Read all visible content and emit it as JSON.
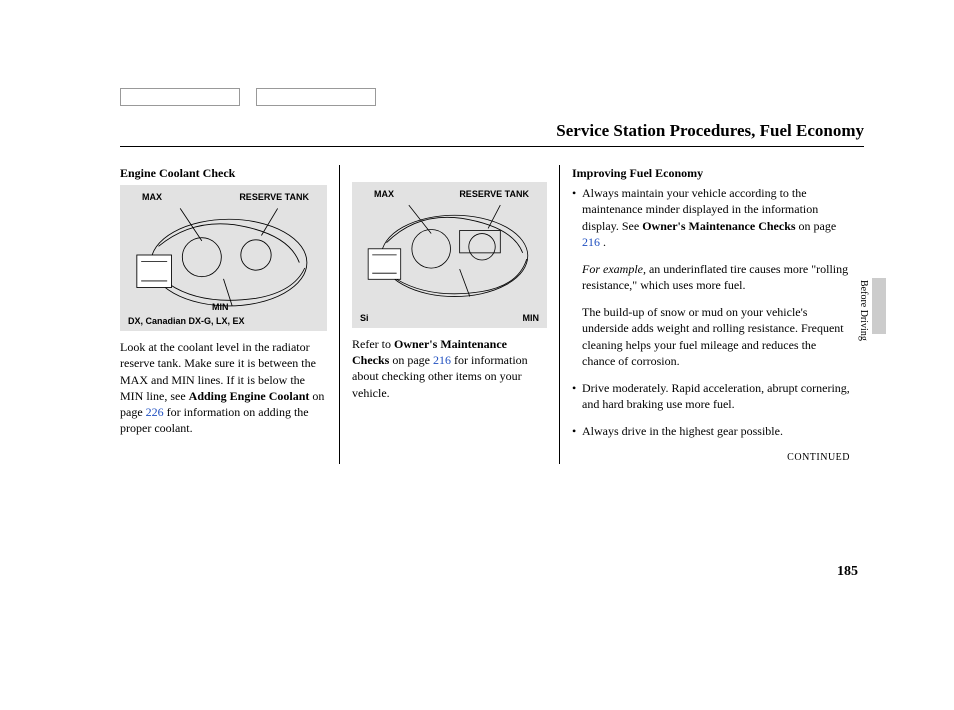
{
  "page": {
    "title": "Service Station Procedures, Fuel Economy",
    "number": "185",
    "side_label": "Before Driving",
    "continued": "CONTINUED"
  },
  "col1": {
    "heading": "Engine Coolant Check",
    "fig": {
      "max": "MAX",
      "reserve": "RESERVE TANK",
      "min": "MIN",
      "caption_left": "DX, Canadian DX-G, LX, EX"
    },
    "para1a": "Look at the coolant level in the radiator reserve tank. Make sure it is between the MAX and MIN lines. If it is below the MIN line, see ",
    "para1b": "Adding Engine Coolant",
    "para1c": " on page ",
    "para1_link": "226",
    "para1d": " for information on adding the proper coolant."
  },
  "col2": {
    "fig": {
      "max": "MAX",
      "reserve": "RESERVE TANK",
      "min": "MIN",
      "caption_left": "Si"
    },
    "para1a": "Refer to ",
    "para1b": "Owner's Maintenance Checks",
    "para1c": " on page ",
    "para1_link": "216",
    "para1d": " for information about checking other items on your vehicle."
  },
  "col3": {
    "heading": "Improving Fuel Economy",
    "b1a": "Always maintain your vehicle according to the maintenance minder displayed in the information display. See ",
    "b1b": "Owner's Maintenance Checks",
    "b1c": " on page ",
    "b1_link": "216",
    "b1d": " .",
    "ex_lead": "For example,",
    "ex_rest": " an underinflated tire causes more \"rolling resistance,\" which uses more fuel.",
    "snow": "The build-up of snow or mud on your vehicle's underside adds weight and rolling resistance. Frequent cleaning helps your fuel mileage and reduces the chance of corrosion.",
    "b2": "Drive moderately. Rapid acceleration, abrupt cornering, and hard braking use more fuel.",
    "b3": "Always drive in the highest gear possible."
  }
}
